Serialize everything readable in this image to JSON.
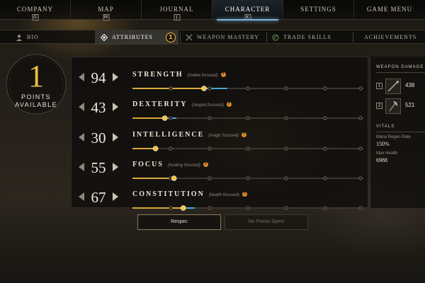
{
  "nav": {
    "items": [
      {
        "label": "COMPANY",
        "key": "G"
      },
      {
        "label": "MAP",
        "key": "M"
      },
      {
        "label": "JOURNAL",
        "key": "J"
      },
      {
        "label": "CHARACTER",
        "key": "K"
      },
      {
        "label": "SETTINGS",
        "key": ""
      },
      {
        "label": "GAME MENU",
        "key": ""
      }
    ],
    "active": "CHARACTER"
  },
  "tabs": {
    "bio": "BIO",
    "attributes": "ATTRIBUTES",
    "attributes_badge": "1",
    "weapon_mastery": "WEAPON MASTERY",
    "trade_skills": "TRADE SKILLS",
    "achievements": "ACHIEVEMENTS",
    "active": "ATTRIBUTES"
  },
  "points": {
    "value": "1",
    "label_line1": "POINTS",
    "label_line2": "AVAILABLE"
  },
  "attributes": [
    {
      "name": "STRENGTH",
      "hint": "(melee focused)",
      "value": "94",
      "fill": 0.31,
      "pending": 0.1
    },
    {
      "name": "DEXTERITY",
      "hint": "(ranged focused)",
      "value": "43",
      "fill": 0.14,
      "pending": 0.05
    },
    {
      "name": "INTELLIGENCE",
      "hint": "(magic focused)",
      "value": "30",
      "fill": 0.1,
      "pending": 0.0
    },
    {
      "name": "FOCUS",
      "hint": "(healing focused)",
      "value": "55",
      "fill": 0.18,
      "pending": 0.0
    },
    {
      "name": "CONSTITUTION",
      "hint": "(health focused)",
      "value": "67",
      "fill": 0.22,
      "pending": 0.05
    }
  ],
  "attr_info_glyph": "?",
  "weapon_damage": {
    "title": "WEAPON DAMAGE",
    "slots": [
      {
        "slot": "1",
        "damage": "438",
        "icon": "spear-icon"
      },
      {
        "slot": "2",
        "damage": "521",
        "icon": "hatchet-icon"
      }
    ]
  },
  "vitals": {
    "title": "VITALS",
    "mana_regen_label": "Mana Regen Rate",
    "mana_regen_value": "150%",
    "max_health_label": "Max Health",
    "max_health_value": "6988"
  },
  "buttons": {
    "respec": "Respec",
    "no_points_spent": "No Points Spent"
  },
  "colors": {
    "accent_gold": "#f0c040",
    "bar_gold": "#d9a93a",
    "bar_blue": "#4aa8d8",
    "active_tab_blue": "#7fb6e0"
  }
}
